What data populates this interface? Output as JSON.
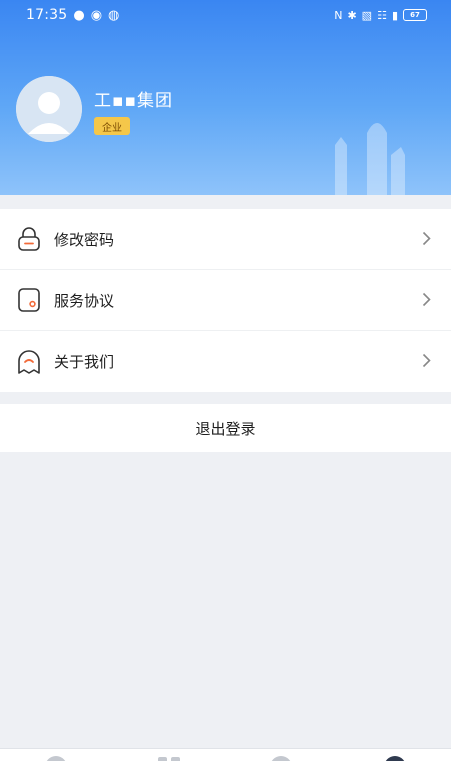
{
  "status_bar": {
    "time": "17:35",
    "battery": "67"
  },
  "profile": {
    "company_name": "工▪▪集团",
    "badge": "企业"
  },
  "menu": {
    "items": [
      {
        "label": "修改密码",
        "icon": "lock-icon"
      },
      {
        "label": "服务协议",
        "icon": "document-icon"
      },
      {
        "label": "关于我们",
        "icon": "about-icon"
      }
    ]
  },
  "logout": {
    "label": "退出登录"
  },
  "tabbar": {
    "icons": [
      "tab-home-icon",
      "tab-apps-icon",
      "tab-message-icon",
      "tab-profile-icon"
    ]
  },
  "colors": {
    "header_top": "#3a86f2",
    "header_bottom": "#8ec3fa",
    "badge": "#f5c74a",
    "background": "#eef0f4"
  }
}
